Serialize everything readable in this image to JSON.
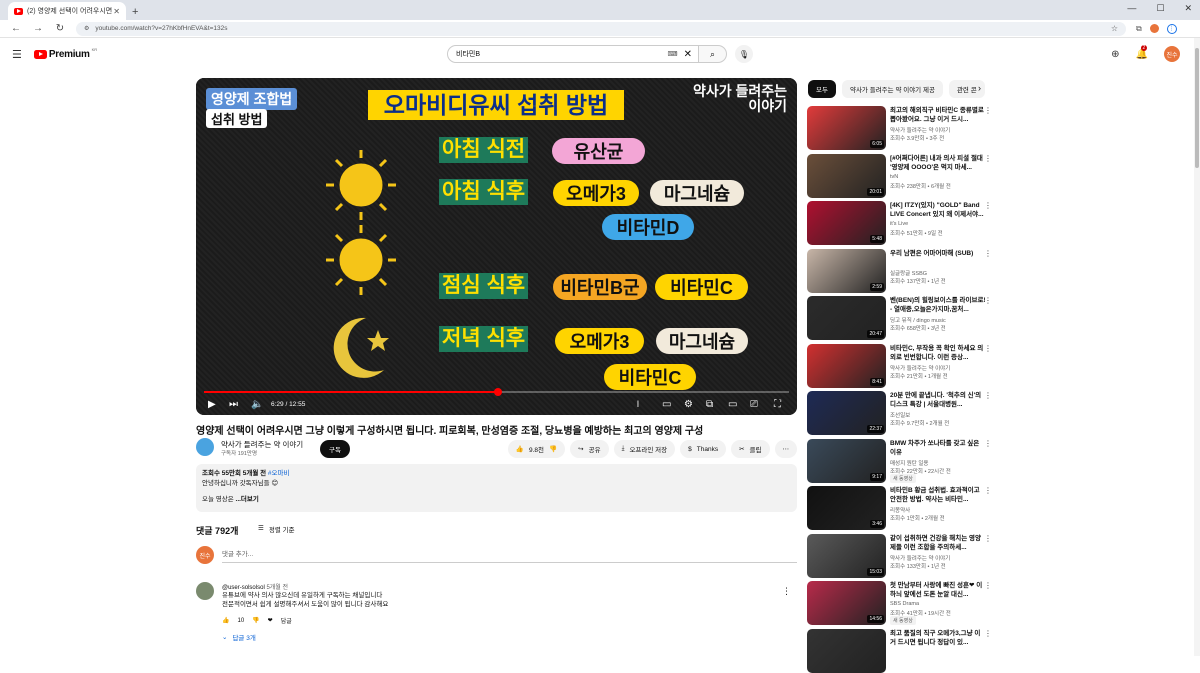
{
  "browser": {
    "tab_title": "(2) 영양제 선택이 어려우시면",
    "url": "youtube.com/watch?v=27hKbfHnEVA&t=132s"
  },
  "header": {
    "logo": "Premium",
    "logo_sup": "KR",
    "search_value": "비타민B",
    "notif_count": "2",
    "avatar": "진수"
  },
  "video": {
    "label1": "영양제 조합법",
    "label2": "섭취 방법",
    "title_banner": "오마비디유씨 섭취 방법",
    "logo_line1": "약사가 들려주는",
    "logo_line2": "이야기",
    "rows": [
      "아침 식전",
      "아침 식후",
      "점심 식후",
      "저녁 식후"
    ],
    "pills": [
      "유산균",
      "오메가3",
      "마그네슘",
      "비타민D",
      "비타민B군",
      "비타민C",
      "오메가3",
      "마그네슘",
      "비타민C"
    ],
    "time": "6:29 / 12:55",
    "progress": 0.502
  },
  "meta": {
    "title": "영양제 선택이 어려우시면 그냥 이렇게 구성하시면 됩니다. 피로회복, 만성염증 조절, 당뇨병을 예방하는 최고의 영양제 구성",
    "channel": "약사가 들려주는 약 이야기",
    "subs": "구독자 191만명",
    "subscribe": "구독",
    "likes": "9.8천",
    "share": "공유",
    "offline": "오프라인 저장",
    "thanks": "Thanks",
    "clip": "클립"
  },
  "description": {
    "stats": "조회수 55만회  5개월 전",
    "tag": "#오마비",
    "line1": "안녕하십니까 갓독자님들 😊",
    "line2": "오늘 영상은 ",
    "more": "...더보기"
  },
  "comments": {
    "count": "댓글 792개",
    "sort": "정렬 기준",
    "placeholder": "댓글 추가...",
    "avatar": "진수",
    "item": {
      "author": "@user-solsolsol",
      "time": "5개월 전",
      "line1": "유튜브에 약사 의사 많으신데 유일하게 구독하는 채널입니다",
      "line2": "전문적이면서 쉽게 설명해주셔서 도움이 많이 됩니다 감사해요",
      "likes": "10",
      "reply": "답글",
      "replies": "답글 3개"
    }
  },
  "sidebar": {
    "chips": [
      "모두",
      "약사가 들려주는 약 이야기 제공",
      "관련 콘"
    ],
    "items": [
      {
        "title": "최고의 해외직구 비타민C 종류별로 뽑아봤어요. 그냥 이거 드시...",
        "channel": "약사가 들려주는 약 이야기",
        "meta": "조회수 3.9만회 • 3주 전",
        "dur": "6:05",
        "color": "#e23b3b"
      },
      {
        "title": "[#어쩌다어른] 내과 의사 피셜 절대 '영양제 OOOO'은 먹지 마세...",
        "channel": "tvN",
        "meta": "조회수 238만회 • 6개월 전",
        "dur": "20:01",
        "color": "#6b4f3a"
      },
      {
        "title": "[4K] ITZY(있지) \"GOLD\" Band LIVE Concert 있지 왜 이제서야...",
        "channel": "it's Live",
        "meta": "조회수 51만회 • 9일 전",
        "dur": "5:48",
        "color": "#b01030"
      },
      {
        "title": "우리 남편은 어마어마해 (SUB)",
        "channel": "실글랑글 SSBG",
        "meta": "조회수 137만회 • 1년 전",
        "dur": "2:59",
        "color": "#c8b6a8"
      },
      {
        "title": "벤(BEN)의 힐링보이스를 라이브로! - 열애중,오늘은가지마,꿈처...",
        "channel": "딩고 뮤직 / dingo music",
        "meta": "조회수 658만회 • 3년 전",
        "dur": "20:47",
        "color": "#2b2b2b"
      },
      {
        "title": "비타민C, 부작용 꼭 확인 하세요 의외로 빈번합니다. 이런 증상...",
        "channel": "약사가 들려주는 약 이야기",
        "meta": "조회수 21만회 • 1개월 전",
        "dur": "8:41",
        "color": "#d23030"
      },
      {
        "title": "20분 만에 끝냅니다. '척추의 신'의 디스크 특강 | 서울대병원...",
        "channel": "조선일보",
        "meta": "조회수 9.7만회 • 2개월 전",
        "dur": "22:37",
        "color": "#1e2a55"
      },
      {
        "title": "BMW 차주가 쏘나타를 갖고 싶은 이유",
        "channel": "매성지 원탄 일용",
        "meta": "조회수 22만회 • 22시간 전",
        "dur": "9:17",
        "color": "#3a4a5a",
        "badge": "새 동영상"
      },
      {
        "title": "비타민B 황금 섭취법. 효과적이고 안전한 방법. 약사는 비타민...",
        "channel": "리몽약사",
        "meta": "조회수 1만회 • 2개월 전",
        "dur": "3:46",
        "color": "#111111"
      },
      {
        "title": "같이 섭취하면 건강을 해치는 영양제들 이런 조합을 주의하세...",
        "channel": "약사가 들려주는 약 이야기",
        "meta": "조회수 133만회 • 1년 전",
        "dur": "15:03",
        "color": "#5a5a5a"
      },
      {
        "title": "첫 만남부터 사랑에 빠진 성훈❤ 이하늬 앞에선 도톤 눈알 대신...",
        "channel": "SBS Drama",
        "meta": "조회수 41만회 • 19시간 전",
        "dur": "14:56",
        "color": "#b82a4a",
        "badge": "새 동영상"
      },
      {
        "title": "최고 품질의 직구 오메가3,그냥 이거 드시면 됩니다 정답이 있...",
        "channel": "",
        "meta": "",
        "dur": "",
        "color": "#333333"
      }
    ]
  }
}
